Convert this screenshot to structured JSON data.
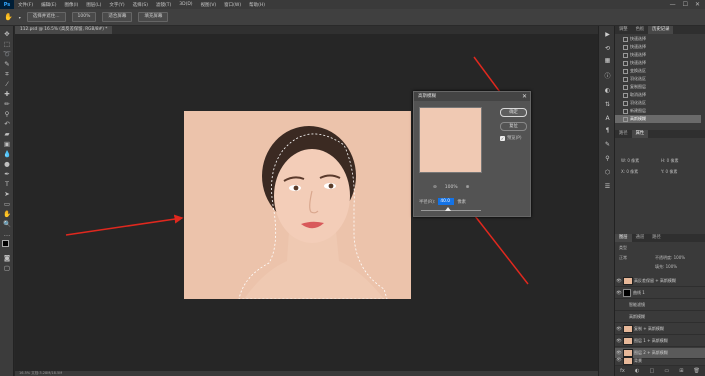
{
  "menubar": {
    "logo": "Ps",
    "items": [
      "文件(F)",
      "编辑(E)",
      "图像(I)",
      "图层(L)",
      "文字(Y)",
      "选择(S)",
      "滤镜(T)",
      "3D(D)",
      "视图(V)",
      "窗口(W)",
      "帮助(H)"
    ],
    "window_controls": [
      "—",
      "☐",
      "✕"
    ]
  },
  "options_bar": {
    "buttons": [
      "选择并遮住...",
      "100%",
      "适合屏幕",
      "填充屏幕"
    ]
  },
  "document": {
    "tab": "112.psd @ 16.5% (高反差保留, RGB/8#) *",
    "status": "16.5%   文档:3.28M/18.5M"
  },
  "dialog": {
    "title": "高斯模糊",
    "close": "✕",
    "ok": "确定",
    "reset": "复位",
    "preview_label": "预览(P)",
    "preview_checked": true,
    "zoom_out": "⊖",
    "zoom": "100%",
    "zoom_in": "⊕",
    "radius_label": "半径(R):",
    "radius_value": "40.0",
    "unit": "像素",
    "slider_fraction": 0.45
  },
  "right_panel": {
    "history_tabs": [
      "调整",
      "色板",
      "历史记录"
    ],
    "history_items": [
      "快速选择",
      "快速选择",
      "快速选择",
      "快速选择",
      "变换选区",
      "羽化选区",
      "复制图层",
      "取消选择",
      "羽化选区",
      "新建图层",
      "高斯模糊"
    ],
    "mid_tabs": [
      "路径",
      "属性"
    ],
    "props": [
      "W: 0 像素",
      "H: 0 像素",
      "X: 0 像素",
      "Y: 0 像素"
    ],
    "layer_tabs": [
      "图层",
      "通道",
      "路径"
    ],
    "layer_kind": "类型",
    "blend_mode": "正常",
    "opacity_label": "不透明度: 100%",
    "fill_label": "填充: 100%",
    "layers": [
      {
        "name": "高反差保留 + 高斯模糊",
        "selected": false
      },
      {
        "name": "曲线 1",
        "selected": false
      },
      {
        "name": "智能滤镜",
        "selected": false
      },
      {
        "name": "高斯模糊",
        "selected": false
      },
      {
        "name": "复制 + 高斯模糊",
        "selected": false
      },
      {
        "name": "图层 1 + 高斯模糊",
        "selected": false
      },
      {
        "name": "图层 2 + 高斯模糊",
        "selected": true
      },
      {
        "name": "背景",
        "selected": false
      }
    ],
    "bottom_icons": [
      "fx",
      "◐",
      "□",
      "▭",
      "⊞",
      "🗑"
    ]
  },
  "colors": {
    "accent": "#1473e6",
    "arrow": "#e0281e",
    "skin": "#ecc3ab"
  }
}
